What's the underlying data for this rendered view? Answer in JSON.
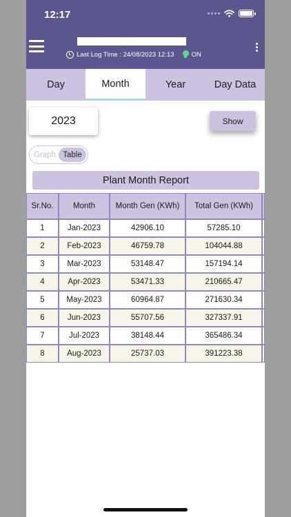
{
  "status_bar": {
    "time": "12:17"
  },
  "header": {
    "log_label": "Last Log Time : 24/08/2023 12:13",
    "status": "ON"
  },
  "tabs": [
    {
      "label": "Day"
    },
    {
      "label": "Month",
      "selected": true
    },
    {
      "label": "Year"
    },
    {
      "label": "Day Data"
    }
  ],
  "controls": {
    "year": "2023",
    "show_label": "Show",
    "toggle": {
      "graph": "Graph",
      "table": "Table",
      "selected": "Table"
    }
  },
  "report": {
    "title": "Plant Month Report",
    "columns": [
      "Sr.No.",
      "Month",
      "Month Gen (KWh)",
      "Total Gen (KWh)"
    ],
    "rows": [
      [
        "1",
        "Jan-2023",
        "42906.10",
        "57285.10"
      ],
      [
        "2",
        "Feb-2023",
        "46759.78",
        "104044.88"
      ],
      [
        "3",
        "Mar-2023",
        "53148.47",
        "157194.14"
      ],
      [
        "4",
        "Apr-2023",
        "53471.33",
        "210665.47"
      ],
      [
        "5",
        "May-2023",
        "60964.87",
        "271630.34"
      ],
      [
        "6",
        "Jun-2023",
        "55707.56",
        "327337.91"
      ],
      [
        "7",
        "Jul-2023",
        "38148.44",
        "365486.34"
      ],
      [
        "8",
        "Aug-2023",
        "25737.03",
        "391223.38"
      ]
    ]
  },
  "colors": {
    "header_bg": "#5c568f",
    "accent": "#cdc3e0",
    "row_alt": "#f7f4e8",
    "border": "#8f86c4",
    "status_on": "#62d98a"
  }
}
